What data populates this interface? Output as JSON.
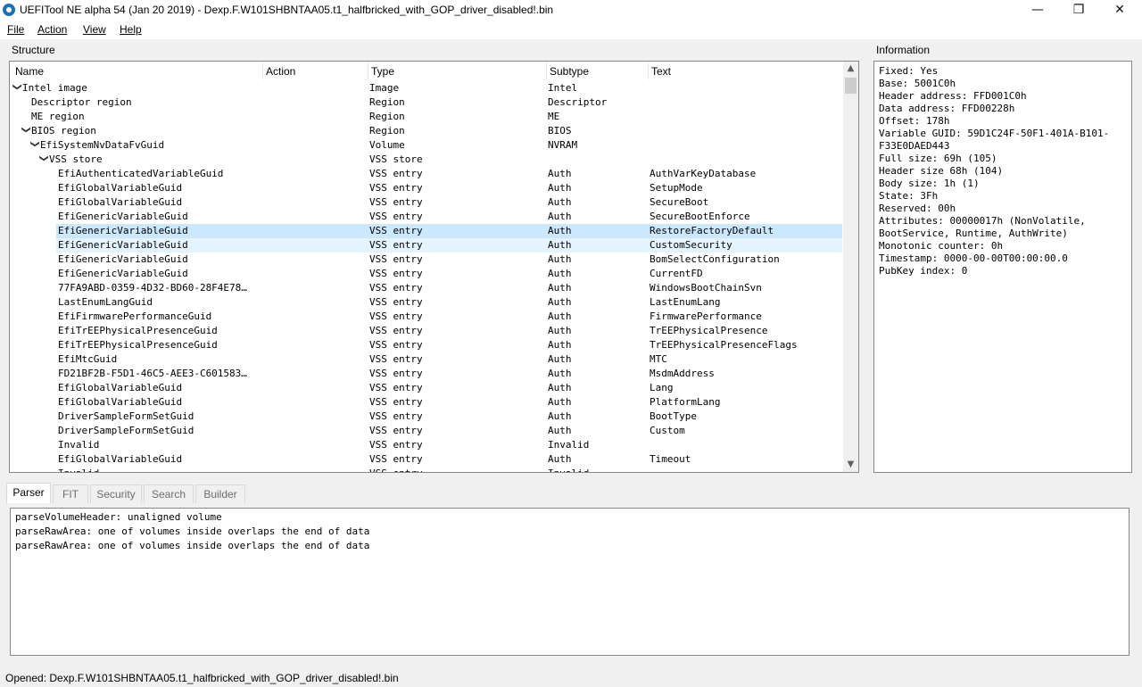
{
  "window": {
    "title": "UEFITool NE alpha 54 (Jan 20 2019) - Dexp.F.W101SHBNTAA05.t1_halfbricked_with_GOP_driver_disabled!.bin",
    "minimize_glyph": "—",
    "maximize_glyph": "❐",
    "close_glyph": "✕"
  },
  "menu": {
    "file": "File",
    "action": "Action",
    "view": "View",
    "help": "Help"
  },
  "structure": {
    "label": "Structure",
    "columns": [
      "Name",
      "Action",
      "Type",
      "Subtype",
      "Text"
    ],
    "rows": [
      {
        "name": "Intel image",
        "action": "",
        "type": "Image",
        "subtype": "Intel",
        "text": "",
        "expanded": "v"
      },
      {
        "name": "Descriptor region",
        "action": "",
        "type": "Region",
        "subtype": "Descriptor",
        "text": "",
        "expanded": ""
      },
      {
        "name": "ME region",
        "action": "",
        "type": "Region",
        "subtype": "ME",
        "text": "",
        "expanded": ""
      },
      {
        "name": "BIOS region",
        "action": "",
        "type": "Region",
        "subtype": "BIOS",
        "text": "",
        "expanded": "v"
      },
      {
        "name": "EfiSystemNvDataFvGuid",
        "action": "",
        "type": "Volume",
        "subtype": "NVRAM",
        "text": "",
        "expanded": "v"
      },
      {
        "name": "VSS store",
        "action": "",
        "type": "VSS store",
        "subtype": "",
        "text": "",
        "expanded": "v"
      },
      {
        "name": "EfiAuthenticatedVariableGuid",
        "action": "",
        "type": "VSS entry",
        "subtype": "Auth",
        "text": "AuthVarKeyDatabase",
        "expanded": ""
      },
      {
        "name": "EfiGlobalVariableGuid",
        "action": "",
        "type": "VSS entry",
        "subtype": "Auth",
        "text": "SetupMode",
        "expanded": ""
      },
      {
        "name": "EfiGlobalVariableGuid",
        "action": "",
        "type": "VSS entry",
        "subtype": "Auth",
        "text": "SecureBoot",
        "expanded": ""
      },
      {
        "name": "EfiGenericVariableGuid",
        "action": "",
        "type": "VSS entry",
        "subtype": "Auth",
        "text": "SecureBootEnforce",
        "expanded": ""
      },
      {
        "name": "EfiGenericVariableGuid",
        "action": "",
        "type": "VSS entry",
        "subtype": "Auth",
        "text": "RestoreFactoryDefault",
        "expanded": ""
      },
      {
        "name": "EfiGenericVariableGuid",
        "action": "",
        "type": "VSS entry",
        "subtype": "Auth",
        "text": "CustomSecurity",
        "expanded": ""
      },
      {
        "name": "EfiGenericVariableGuid",
        "action": "",
        "type": "VSS entry",
        "subtype": "Auth",
        "text": "BomSelectConfiguration",
        "expanded": ""
      },
      {
        "name": "EfiGenericVariableGuid",
        "action": "",
        "type": "VSS entry",
        "subtype": "Auth",
        "text": "CurrentFD",
        "expanded": ""
      },
      {
        "name": "77FA9ABD-0359-4D32-BD60-28F4E78…",
        "action": "",
        "type": "VSS entry",
        "subtype": "Auth",
        "text": "WindowsBootChainSvn",
        "expanded": ""
      },
      {
        "name": "LastEnumLangGuid",
        "action": "",
        "type": "VSS entry",
        "subtype": "Auth",
        "text": "LastEnumLang",
        "expanded": ""
      },
      {
        "name": "EfiFirmwarePerformanceGuid",
        "action": "",
        "type": "VSS entry",
        "subtype": "Auth",
        "text": "FirmwarePerformance",
        "expanded": ""
      },
      {
        "name": "EfiTrEEPhysicalPresenceGuid",
        "action": "",
        "type": "VSS entry",
        "subtype": "Auth",
        "text": "TrEEPhysicalPresence",
        "expanded": ""
      },
      {
        "name": "EfiTrEEPhysicalPresenceGuid",
        "action": "",
        "type": "VSS entry",
        "subtype": "Auth",
        "text": "TrEEPhysicalPresenceFlags",
        "expanded": ""
      },
      {
        "name": "EfiMtcGuid",
        "action": "",
        "type": "VSS entry",
        "subtype": "Auth",
        "text": "MTC",
        "expanded": ""
      },
      {
        "name": "FD21BF2B-F5D1-46C5-AEE3-C601583…",
        "action": "",
        "type": "VSS entry",
        "subtype": "Auth",
        "text": "MsdmAddress",
        "expanded": ""
      },
      {
        "name": "EfiGlobalVariableGuid",
        "action": "",
        "type": "VSS entry",
        "subtype": "Auth",
        "text": "Lang",
        "expanded": ""
      },
      {
        "name": "EfiGlobalVariableGuid",
        "action": "",
        "type": "VSS entry",
        "subtype": "Auth",
        "text": "PlatformLang",
        "expanded": ""
      },
      {
        "name": "DriverSampleFormSetGuid",
        "action": "",
        "type": "VSS entry",
        "subtype": "Auth",
        "text": "BootType",
        "expanded": ""
      },
      {
        "name": "DriverSampleFormSetGuid",
        "action": "",
        "type": "VSS entry",
        "subtype": "Auth",
        "text": "Custom",
        "expanded": ""
      },
      {
        "name": "Invalid",
        "action": "",
        "type": "VSS entry",
        "subtype": "Invalid",
        "text": "",
        "expanded": ""
      },
      {
        "name": "EfiGlobalVariableGuid",
        "action": "",
        "type": "VSS entry",
        "subtype": "Auth",
        "text": "Timeout",
        "expanded": ""
      },
      {
        "name": "Invalid",
        "action": "",
        "type": "VSS entry",
        "subtype": "Invalid",
        "text": "",
        "expanded": ""
      }
    ],
    "selected_row_index": 10,
    "hover_row_index": 11
  },
  "information": {
    "label": "Information",
    "lines": [
      "Fixed: Yes",
      "Base: 5001C0h",
      "Header address: FFD001C0h",
      "Data address: FFD00228h",
      "Offset: 178h",
      "Variable GUID: 59D1C24F-50F1-401A-B101-",
      "F33E0DAED443",
      "Full size: 69h (105)",
      "Header size 68h (104)",
      "Body size: 1h (1)",
      "State: 3Fh",
      "Reserved: 00h",
      "Attributes: 00000017h (NonVolatile,",
      "BootService, Runtime, AuthWrite)",
      "Monotonic counter: 0h",
      "Timestamp: 0000-00-00T00:00:00.0",
      "PubKey index: 0"
    ]
  },
  "tabs": [
    "Parser",
    "FIT",
    "Security",
    "Search",
    "Builder"
  ],
  "active_tab": "Parser",
  "messages": [
    "parseVolumeHeader: unaligned volume",
    "parseRawArea: one of volumes inside overlaps the end of data",
    "parseRawArea: one of volumes inside overlaps the end of data"
  ],
  "status": "Opened: Dexp.F.W101SHBNTAA05.t1_halfbricked_with_GOP_driver_disabled!.bin",
  "colors": {
    "selection": "#cce8ff",
    "hover": "#e5f3ff"
  }
}
